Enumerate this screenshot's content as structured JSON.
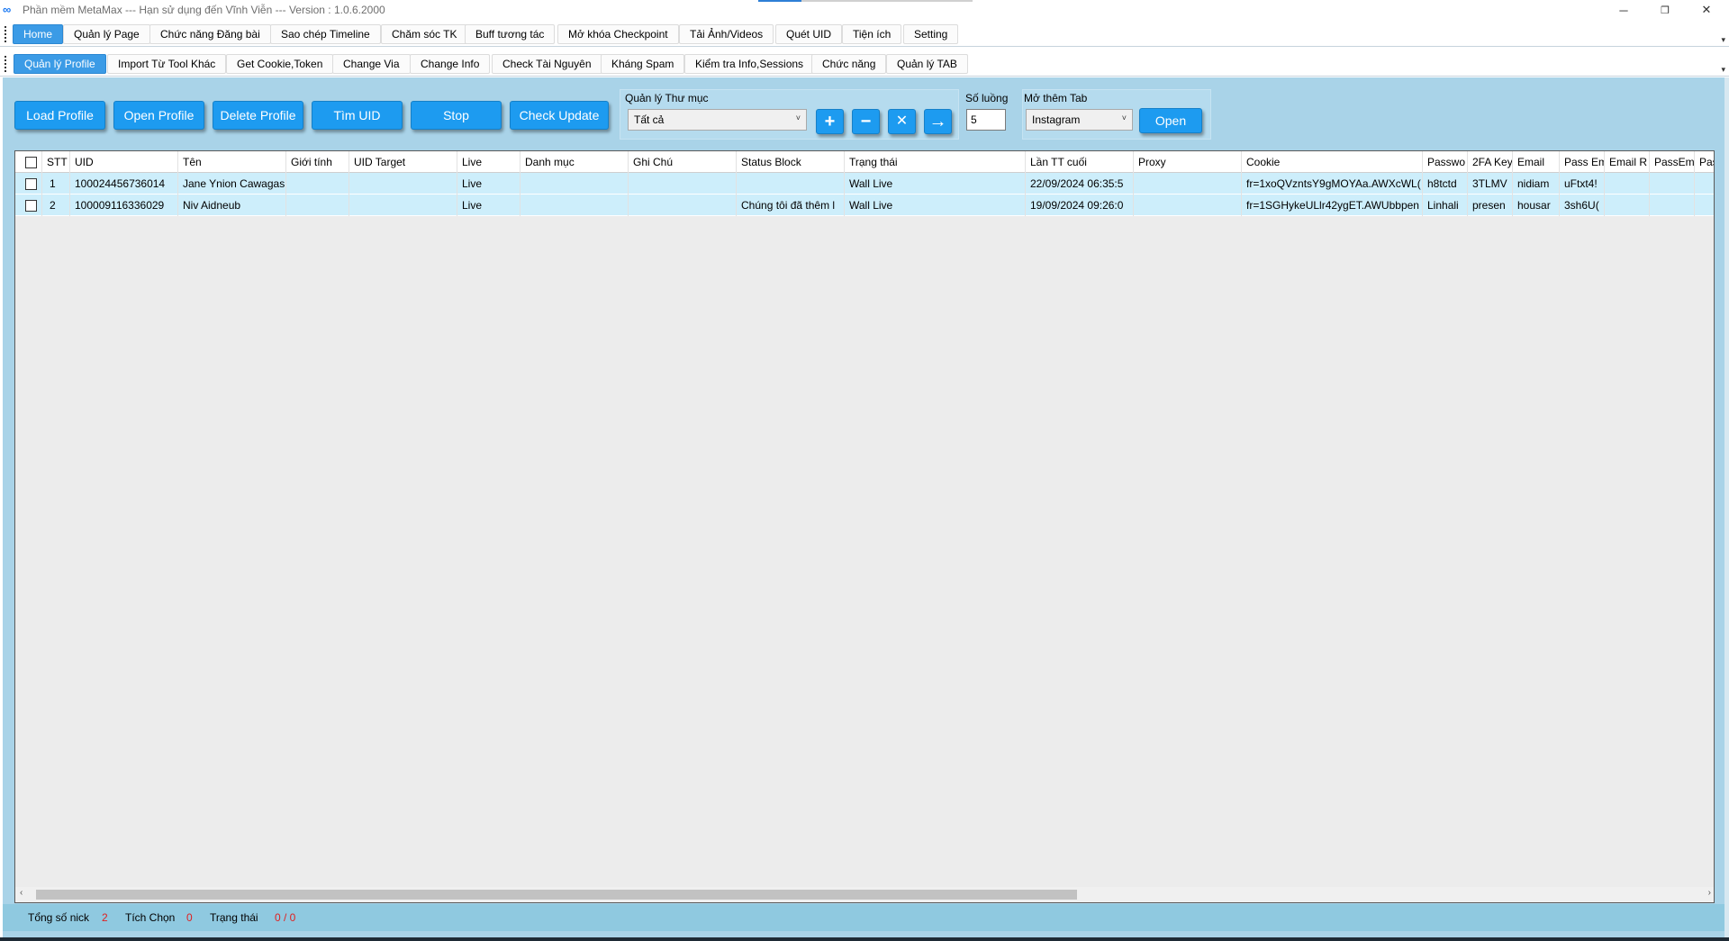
{
  "window": {
    "title": "Phần mềm MetaMax --- Hạn sử dụng đến Vĩnh Viễn --- Version : 1.0.6.2000",
    "logo_glyph": "∞",
    "minimize_glyph": "─",
    "restore_glyph": "❐",
    "close_glyph": "✕"
  },
  "main_tabs": [
    {
      "label": "Home",
      "active": true
    },
    {
      "label": "Quản lý Page"
    },
    {
      "label": "Chức năng Đăng bài"
    },
    {
      "label": "Sao chép Timeline"
    },
    {
      "label": "Chăm sóc TK"
    },
    {
      "label": "Buff tương tác"
    },
    {
      "label": "Mở khóa Checkpoint"
    },
    {
      "label": "Tải Ảnh/Videos"
    },
    {
      "label": "Quét UID"
    },
    {
      "label": "Tiện ích"
    },
    {
      "label": "Setting"
    }
  ],
  "sub_tabs": [
    {
      "label": "Quản lý Profile",
      "active": true
    },
    {
      "label": "Import Từ Tool Khác"
    },
    {
      "label": "Get Cookie,Token"
    },
    {
      "label": "Change Via"
    },
    {
      "label": "Change Info"
    },
    {
      "label": "Check Tài Nguyên"
    },
    {
      "label": "Kháng Spam"
    },
    {
      "label": "Kiểm tra Info,Sessions"
    },
    {
      "label": "Chức năng"
    },
    {
      "label": "Quản lý TAB"
    }
  ],
  "overflow_glyph": "▾",
  "toolbar": {
    "load_profile": "Load Profile",
    "open_profile": "Open Profile",
    "delete_profile": "Delete Profile",
    "tim_uid": "Tìm UID",
    "stop": "Stop",
    "check_update": "Check Update"
  },
  "folder": {
    "label": "Quản lý Thư mục",
    "selected": "Tất cả",
    "add_glyph": "+",
    "remove_glyph": "−",
    "delete_glyph": "✕",
    "go_glyph": "→"
  },
  "quantity": {
    "label": "Số luồng",
    "value": "5"
  },
  "open_tab": {
    "label": "Mở thêm Tab",
    "selected": "Instagram",
    "open_label": "Open"
  },
  "dropdown_arrow": "˅",
  "table": {
    "columns": [
      "",
      "STT",
      "UID",
      "Tên",
      "Giới tính",
      "UID Target",
      "Live",
      "Danh mục",
      "Ghi Chú",
      "Status Block",
      "Trạng thái",
      "Lần TT cuối",
      "Proxy",
      "Cookie",
      "Passwo",
      "2FA Key",
      "Email",
      "Pass Em",
      "Email R",
      "PassEm",
      "Pas"
    ],
    "rows": [
      [
        "",
        "1",
        "100024456736014",
        "Jane Ynion Cawagas",
        "",
        "",
        "Live",
        "",
        "",
        "",
        "Wall Live",
        "22/09/2024 06:35:5",
        "",
        "fr=1xoQVzntsY9gMOYAa.AWXcWL(",
        "h8tctd",
        "3TLMV",
        "nidiam",
        "uFtxt4!",
        "",
        "",
        ""
      ],
      [
        "",
        "2",
        "100009116336029",
        "Niv Aidneub",
        "",
        "",
        "Live",
        "",
        "",
        "Chúng tôi đã thêm l",
        "Wall Live",
        "19/09/2024 09:26:0",
        "",
        "fr=1SGHykeULlr42ygET.AWUbbpen",
        "Linhali",
        "presen",
        "housar",
        "3sh6U(",
        "",
        "",
        ""
      ]
    ]
  },
  "scroll": {
    "left_glyph": "‹",
    "right_glyph": "›"
  },
  "status": {
    "total_label": "Tổng số nick",
    "total_value": "2",
    "checked_label": "Tích Chọn",
    "checked_value": "0",
    "state_label": "Trạng thái",
    "state_value": "0 / 0"
  }
}
